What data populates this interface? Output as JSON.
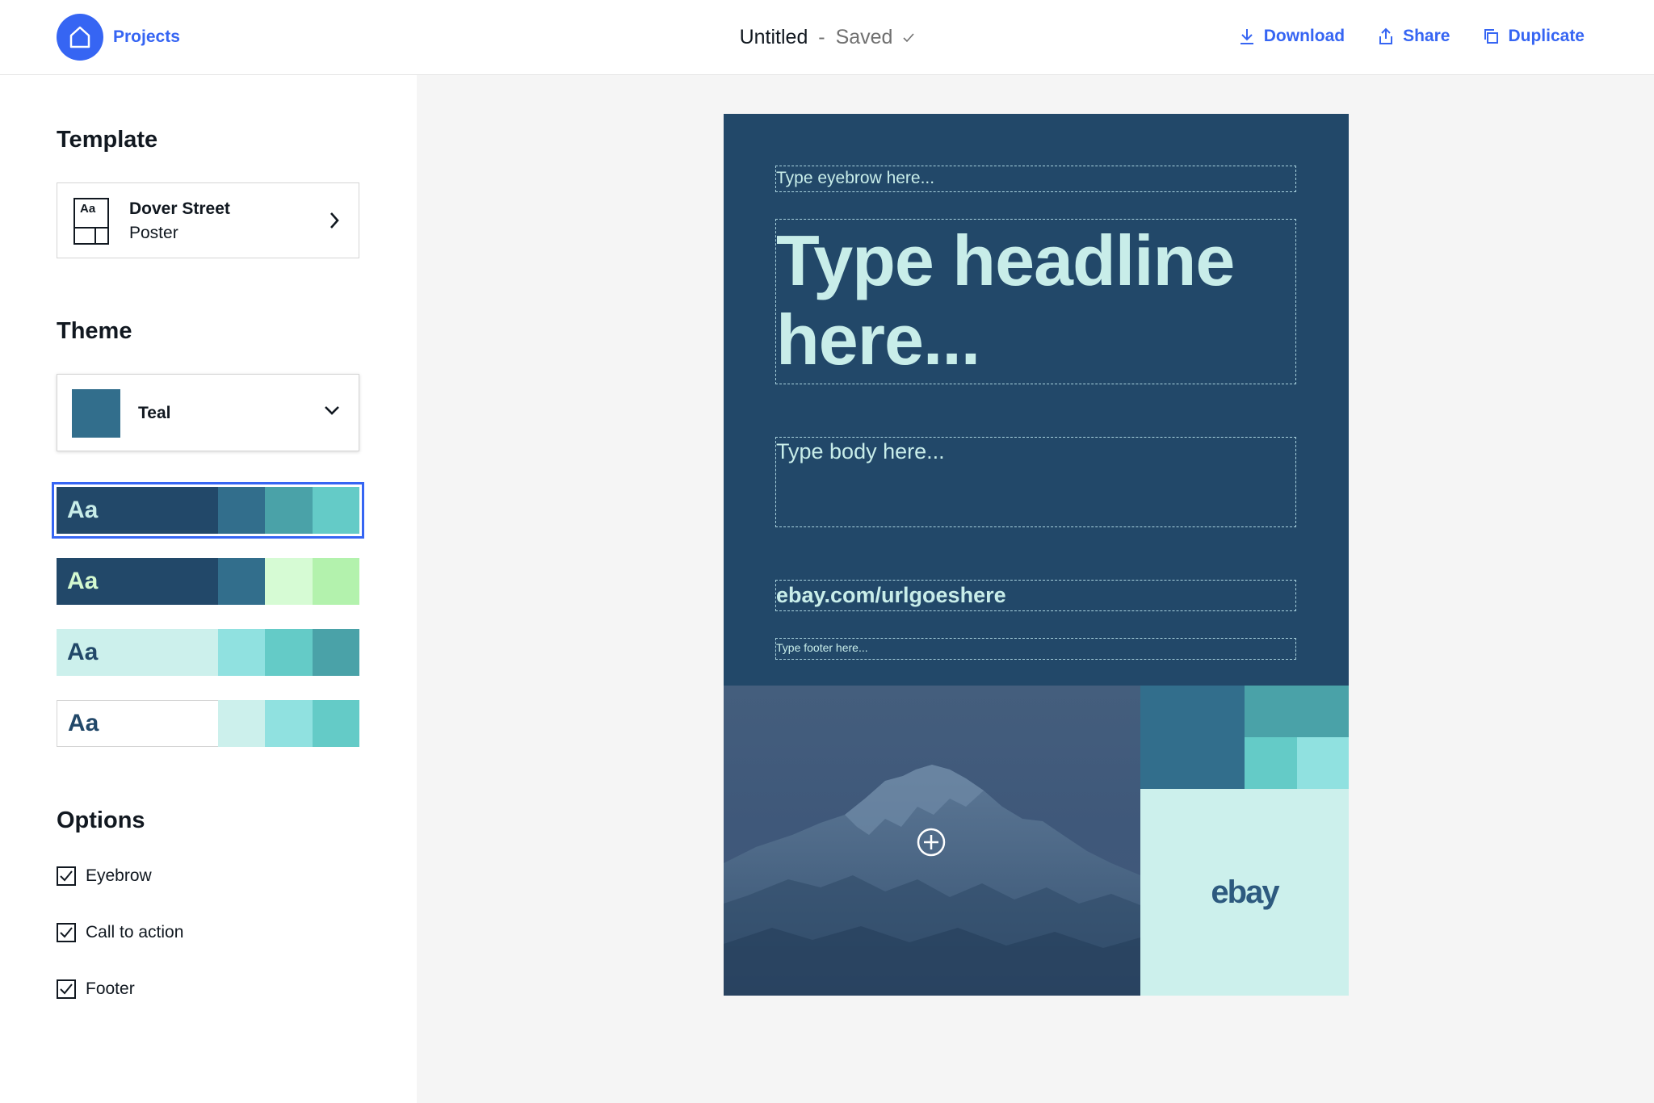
{
  "header": {
    "projects_label": "Projects",
    "doc_title": "Untitled",
    "separator": "-",
    "status": "Saved",
    "actions": {
      "download": "Download",
      "share": "Share",
      "duplicate": "Duplicate"
    }
  },
  "sidebar": {
    "template_heading": "Template",
    "template": {
      "thumb_label": "Aa",
      "name": "Dover Street",
      "type": "Poster"
    },
    "theme_heading": "Theme",
    "theme": {
      "selected": "Teal",
      "swatch_color": "#326e8c"
    },
    "palettes": [
      {
        "label": "Aa",
        "selected": true,
        "main_bg": "#224869",
        "text_color": "#c8ede9",
        "swatches": [
          "#326e8c",
          "#4aa2a8",
          "#64cbc7"
        ]
      },
      {
        "label": "Aa",
        "selected": false,
        "main_bg": "#224869",
        "text_color": "#d4f9d0",
        "swatches": [
          "#326e8c",
          "#d6fbd4",
          "#b3f2ad"
        ]
      },
      {
        "label": "Aa",
        "selected": false,
        "main_bg": "#ccf0ec",
        "text_color": "#224869",
        "swatches": [
          "#90e1e0",
          "#64cbc7",
          "#4aa2a8"
        ]
      },
      {
        "label": "Aa",
        "selected": false,
        "main_bg": "#ffffff",
        "text_color": "#224869",
        "swatches": [
          "#ccf0ec",
          "#90e1e0",
          "#64cbc7"
        ]
      }
    ],
    "options_heading": "Options",
    "options": [
      {
        "label": "Eyebrow",
        "checked": true
      },
      {
        "label": "Call to action",
        "checked": true
      },
      {
        "label": "Footer",
        "checked": true
      }
    ]
  },
  "poster": {
    "eyebrow_placeholder": "Type eyebrow here...",
    "headline_line1": "Type headline",
    "headline_line2": "here...",
    "body_placeholder": "Type body here...",
    "url": "ebay.com/urlgoeshere",
    "footer_placeholder": "Type footer here...",
    "logo": "ebay",
    "colors": {
      "bg": "#224869",
      "text": "#c8ede9",
      "block_a": "#326e8c",
      "block_b": "#4aa2a8",
      "block_c": "#64cbc7",
      "block_d": "#90e1e0",
      "logo_bg": "#ccf0ec"
    }
  },
  "colors": {
    "accent": "#3665f3",
    "canvas_bg": "#f5f5f5"
  }
}
